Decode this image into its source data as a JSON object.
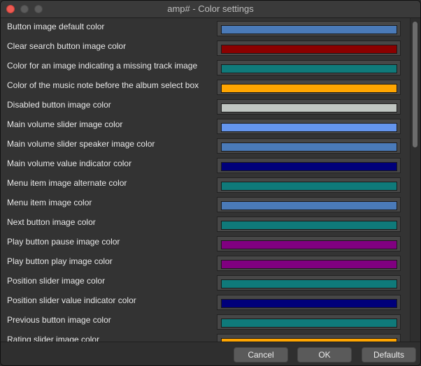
{
  "window": {
    "title": "amp# - Color settings"
  },
  "settings": [
    {
      "label": "Button image default color",
      "color": "#4a7ab8"
    },
    {
      "label": "Clear search button image color",
      "color": "#8b0000"
    },
    {
      "label": "Color for an image indicating a missing track image",
      "color": "#0f7a7a"
    },
    {
      "label": "Color of the music note before the album select box",
      "color": "#ffa500"
    },
    {
      "label": "Disabled button image color",
      "color": "#c0c6c2"
    },
    {
      "label": "Main volume slider image color",
      "color": "#6495ed"
    },
    {
      "label": "Main volume slider speaker image color",
      "color": "#4a7ab8"
    },
    {
      "label": "Main volume value indicator color",
      "color": "#00007a"
    },
    {
      "label": "Menu item image alternate color",
      "color": "#0f7a7a"
    },
    {
      "label": "Menu item image color",
      "color": "#4a7ab8"
    },
    {
      "label": "Next button image color",
      "color": "#0f7a7a"
    },
    {
      "label": "Play button pause image color",
      "color": "#800080"
    },
    {
      "label": "Play button play image color",
      "color": "#800080"
    },
    {
      "label": "Position slider image color",
      "color": "#0f7a7a"
    },
    {
      "label": "Position slider value indicator color",
      "color": "#00007a"
    },
    {
      "label": "Previous button image color",
      "color": "#0f7a7a"
    },
    {
      "label": "Rating slider image color",
      "color": "#ffa500"
    }
  ],
  "buttons": {
    "cancel": "Cancel",
    "ok": "OK",
    "defaults": "Defaults"
  }
}
